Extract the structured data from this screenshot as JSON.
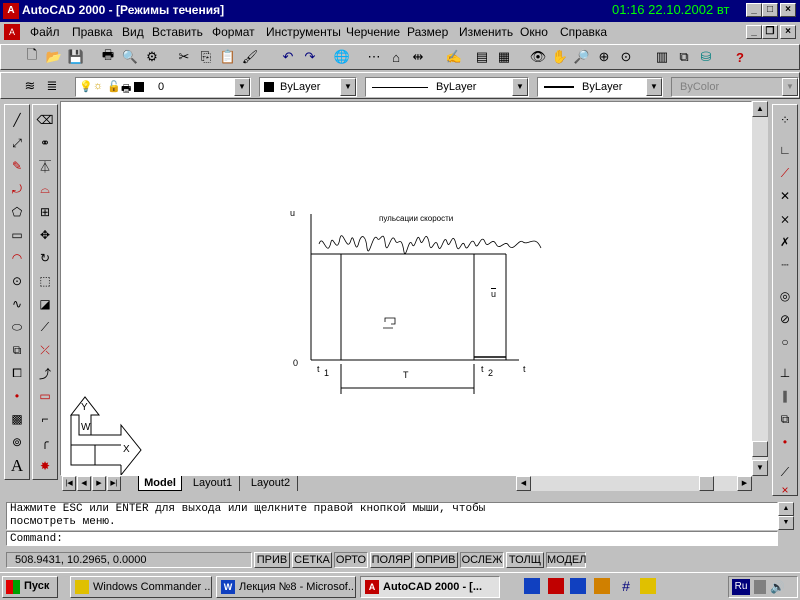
{
  "window": {
    "title": "AutoCAD 2000 - [Режимы течения]",
    "clock": "01:16  22.10.2002  вт",
    "buttons": {
      "minimize": "_",
      "maximize": "□",
      "close": "×"
    }
  },
  "menubar": {
    "items": [
      "Файл",
      "Правка",
      "Вид",
      "Вставить",
      "Формат",
      "Инструменты",
      "Черчение",
      "Размер",
      "Изменить",
      "Окно",
      "Справка"
    ]
  },
  "properties_toolbar": {
    "layer": "0",
    "color": "ByLayer",
    "linetype": "ByLayer",
    "lineweight": "ByLayer",
    "plotstyle": "ByColor"
  },
  "drawing": {
    "axis_u": "u",
    "title": "пульсации скорости",
    "u_bar": "u",
    "origin": "0",
    "t1": "t",
    "t1_sub": "1",
    "t2": "t",
    "t2_sub": "2",
    "t_axis": "t",
    "period": "T",
    "ucs_y": "Y",
    "ucs_w": "W",
    "ucs_x": "X"
  },
  "tabs": [
    "Model",
    "Layout1",
    "Layout2"
  ],
  "command": {
    "history_line1": "Нажмите ESC или ENTER для выхода или щелкните правой кнопкой мыши, чтобы",
    "history_line2": "посмотреть меню.",
    "prompt": "Command:"
  },
  "statusbar": {
    "coords": "508.9431, 10.2965, 0.0000",
    "buttons": [
      "ПРИВ",
      "СЕТКА",
      "ОРТО",
      "ПОЛЯР",
      "ОПРИВ",
      "ОСЛЕЖ",
      "ТОЛЩ",
      "МОДЕЛ"
    ]
  },
  "taskbar": {
    "start": "Пуск",
    "tasks": [
      "Windows Commander ...",
      "Лекция №8 - Microsof...",
      "AutoCAD 2000 - [..."
    ],
    "lang": "Ru"
  }
}
